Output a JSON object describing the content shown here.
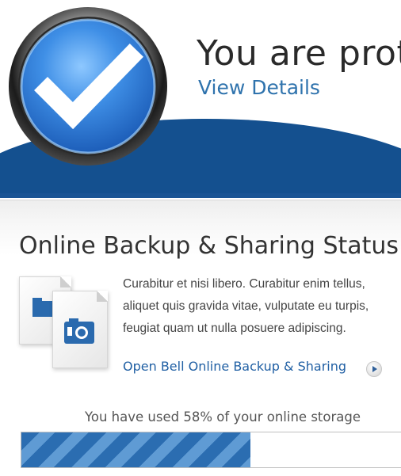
{
  "hero": {
    "title": "You are protected",
    "link_label": "View Details",
    "status_icon": "check-shield-icon"
  },
  "panel": {
    "title": "Online Backup & Sharing Status",
    "description_lines": [
      "Curabitur et nisi libero. Curabitur enim tellus,",
      "aliquet quis gravida vitae, vulputate eu turpis,",
      "feugiat quam ut nulla posuere adipiscing."
    ],
    "open_link_label": "Open Bell Online Backup & Sharing",
    "open_link_icon": "play-arrow-icon",
    "storage": {
      "usage_text": "You have used 58% of your online storage",
      "used_fraction": 0.58
    }
  },
  "colors": {
    "brand_blue": "#14508f",
    "link_blue": "#2f73ad",
    "progress_blue": "#2b6db1"
  }
}
